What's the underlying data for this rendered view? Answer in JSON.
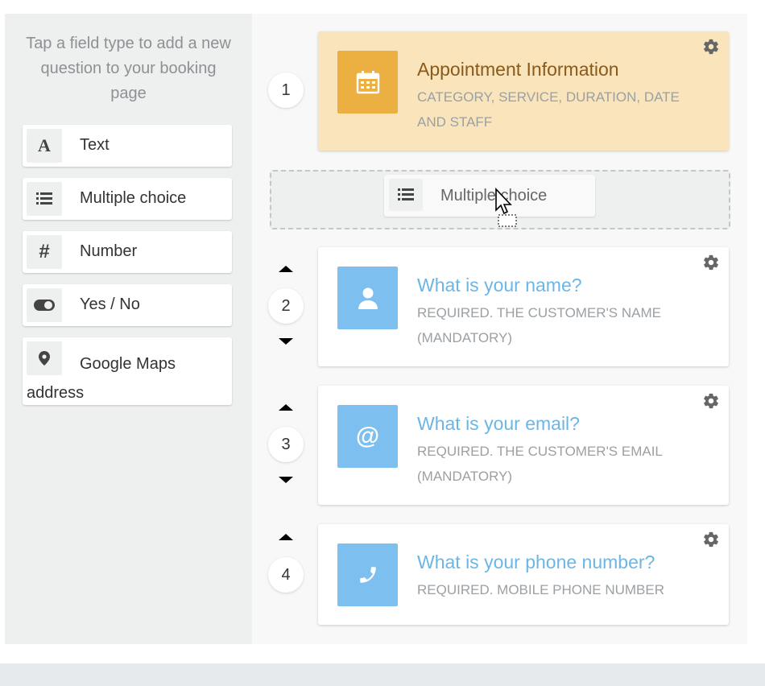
{
  "sidebar": {
    "hint": "Tap a field type to add a new question to your booking page",
    "field_types": [
      {
        "label": "Text",
        "icon": "text-format-icon"
      },
      {
        "label": "Multiple choice",
        "icon": "list-icon"
      },
      {
        "label": "Number",
        "icon": "hash-icon"
      },
      {
        "label": "Yes / No",
        "icon": "toggle-icon"
      },
      {
        "label": "Google Maps address",
        "icon": "map-pin-icon"
      }
    ]
  },
  "dropzone": {
    "item_label": "Multiple choice",
    "item_icon": "list-icon"
  },
  "questions": [
    {
      "number": "1",
      "title": "Appointment Information",
      "subtitle": "CATEGORY, SERVICE, DURATION, DATE AND STAFF",
      "icon": "calendar-icon",
      "color": "#ecaf42"
    },
    {
      "number": "2",
      "title": "What is your name?",
      "subtitle": "REQUIRED. THE CUSTOMER'S NAME (MANDATORY)",
      "icon": "user-icon",
      "color": "#7dbfee"
    },
    {
      "number": "3",
      "title": "What is your email?",
      "subtitle": "REQUIRED. THE CUSTOMER'S EMAIL (MANDATORY)",
      "icon": "at-sign-icon",
      "color": "#7dbfee"
    },
    {
      "number": "4",
      "title": "What is your phone number?",
      "subtitle": "REQUIRED. MOBILE PHONE NUMBER",
      "icon": "phone-icon",
      "color": "#7dbfee"
    }
  ],
  "colors": {
    "appointment_title": "#8a5a1a",
    "question_title": "#6cb6e6",
    "subtitle": "#9aa0a4",
    "sidebar_bg": "#eef0ef",
    "builder_bg": "#f8f8f8"
  }
}
